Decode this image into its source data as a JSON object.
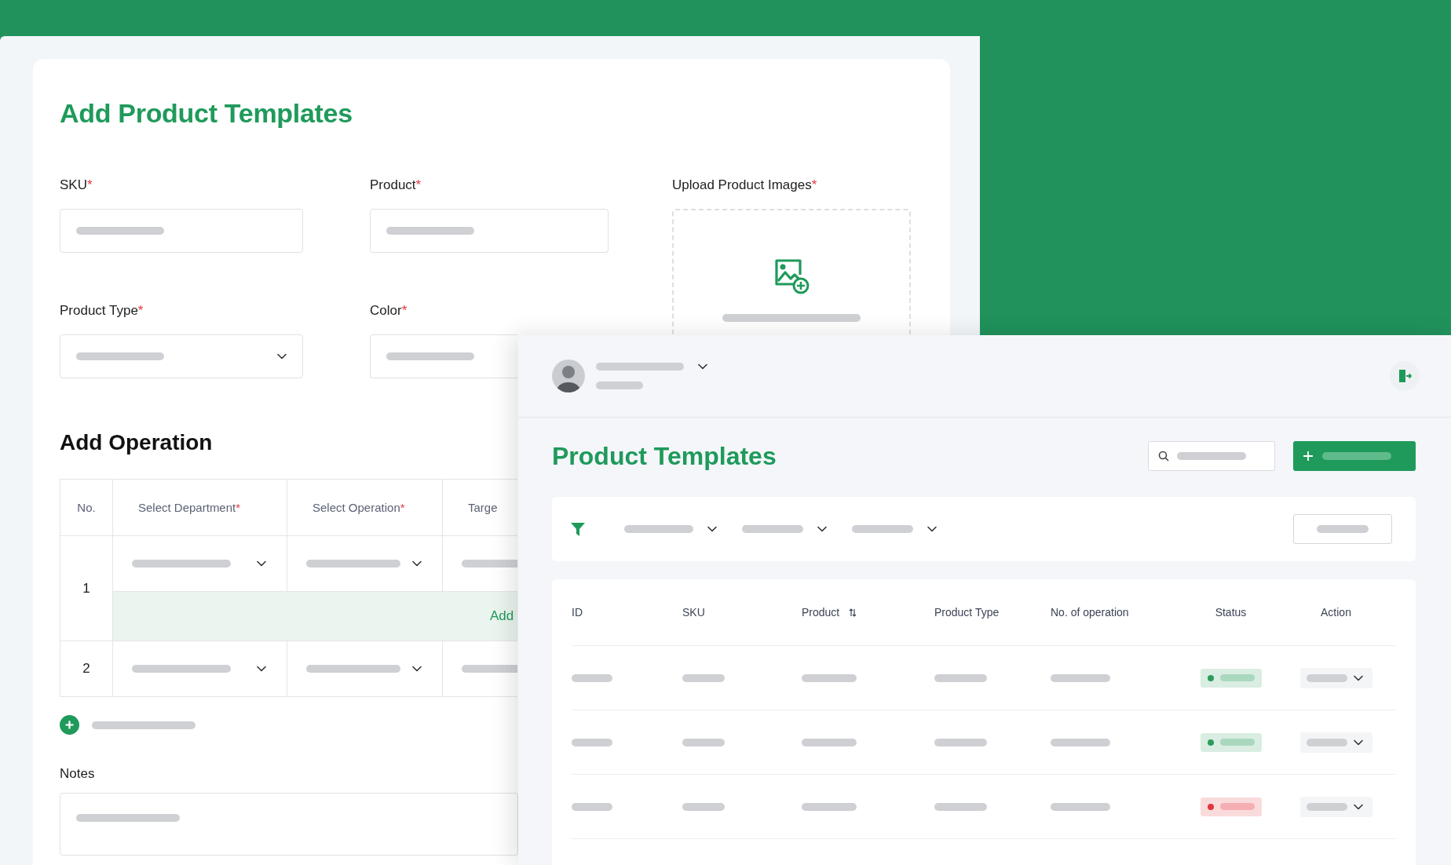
{
  "form_window": {
    "title": "Add Product Templates",
    "fields": [
      {
        "label": "SKU",
        "required_mark": "*",
        "kind": "text"
      },
      {
        "label": "Product",
        "required_mark": "*",
        "kind": "text"
      },
      {
        "label": "Product Type",
        "required_mark": "*",
        "kind": "select"
      },
      {
        "label": "Color",
        "required_mark": "*",
        "kind": "text"
      }
    ],
    "upload": {
      "label": "Upload Product Images",
      "required_mark": "*"
    },
    "operation_section": {
      "title": "Add Operation",
      "columns": [
        {
          "label": "No."
        },
        {
          "label": "Select Department",
          "required_mark": "*"
        },
        {
          "label": "Select Operation",
          "required_mark": "*"
        },
        {
          "label": "Targe"
        }
      ],
      "rows": [
        {
          "no": "1",
          "add_link": "Add"
        },
        {
          "no": "2"
        }
      ]
    },
    "notes": {
      "label": "Notes"
    }
  },
  "list_window": {
    "title": "Product Templates",
    "columns": [
      {
        "label": "ID",
        "sortable": false
      },
      {
        "label": "SKU",
        "sortable": false
      },
      {
        "label": "Product",
        "sortable": true
      },
      {
        "label": "Product Type",
        "sortable": false
      },
      {
        "label": "No. of operation",
        "sortable": false
      },
      {
        "label": "Status",
        "sortable": false
      },
      {
        "label": "Action",
        "sortable": false
      }
    ],
    "rows": [
      {
        "color": "#2a9d5c"
      },
      {
        "color": "#2a9d5c"
      },
      {
        "color": "#e5353f"
      }
    ]
  }
}
